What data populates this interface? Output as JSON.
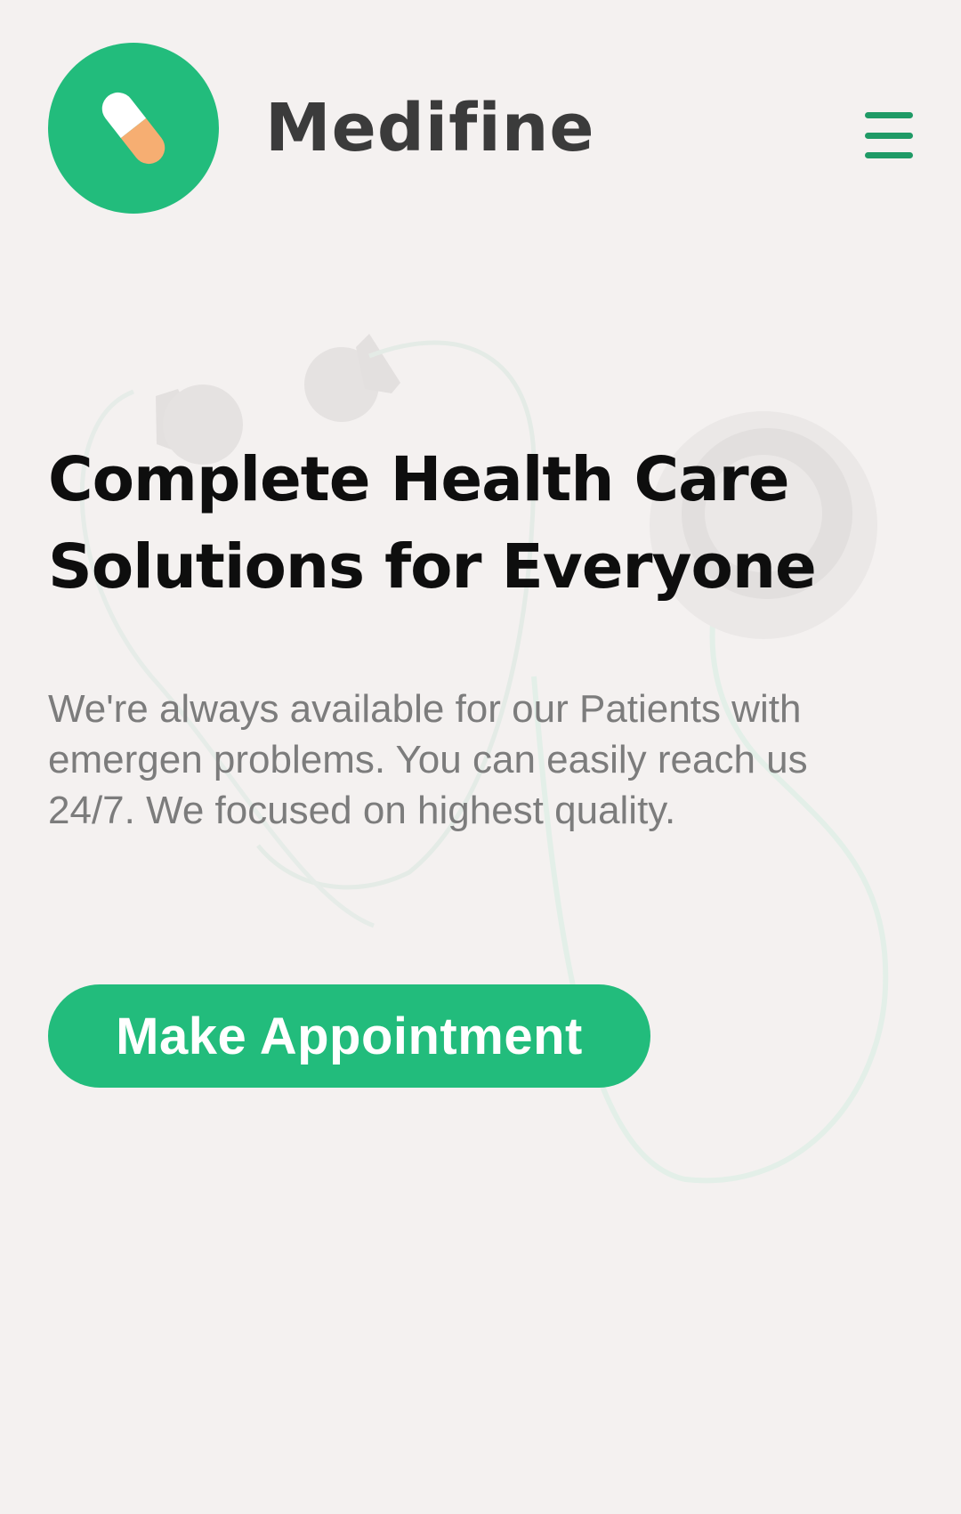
{
  "brand": {
    "name": "Medifine",
    "logo_icon": "pill-icon",
    "accent_color": "#22bc7c",
    "pill_color_top": "#ffffff",
    "pill_color_bottom": "#f6ae72"
  },
  "nav": {
    "menu_icon": "hamburger-menu-icon"
  },
  "hero": {
    "title_line1": "Complete Health Care",
    "title_line2": "Solutions for Everyone",
    "description": "We're always available for our Patients with emergen problems. You can easily reach us 24/7. We focused on highest quality.",
    "cta_label": "Make Appointment",
    "background_icon": "stethoscope-icon"
  }
}
